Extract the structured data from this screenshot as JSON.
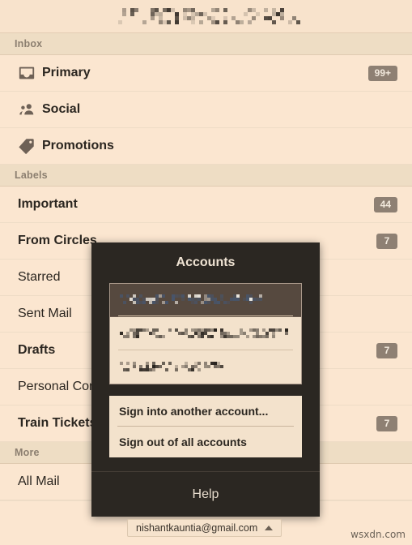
{
  "window": {
    "title_redacted": true,
    "title_placeholder": "▮▮▮▮ ▮ ▮▮ ▮ ▮▮ ▮▮ ▮"
  },
  "sections": [
    {
      "header": "Inbox",
      "rows": [
        {
          "label": "Primary",
          "icon": "inbox-icon",
          "badge": "99+",
          "bold": true
        },
        {
          "label": "Social",
          "icon": "people-icon",
          "badge": "",
          "bold": true
        },
        {
          "label": "Promotions",
          "icon": "price-tag-icon",
          "badge": "",
          "bold": true
        }
      ]
    },
    {
      "header": "Labels",
      "rows": [
        {
          "label": "Important",
          "icon": "",
          "badge": "44",
          "bold": true
        },
        {
          "label": "From Circles",
          "icon": "",
          "badge": "7",
          "bold": true
        },
        {
          "label": "Starred",
          "icon": "",
          "badge": "",
          "bold": false
        },
        {
          "label": "Sent Mail",
          "icon": "",
          "badge": "",
          "bold": false
        },
        {
          "label": "Drafts",
          "icon": "",
          "badge": "7",
          "bold": true
        },
        {
          "label": "Personal Conversations",
          "icon": "",
          "badge": "",
          "bold": false
        },
        {
          "label": "Train Tickets",
          "icon": "",
          "badge": "7",
          "bold": true
        }
      ]
    },
    {
      "header": "More",
      "rows": [
        {
          "label": "All Mail",
          "icon": "",
          "badge": "",
          "bold": false
        }
      ]
    }
  ],
  "dialog": {
    "title": "Accounts",
    "accounts": [
      {
        "redacted": true,
        "selected": true,
        "placeholder": "▮▮▮ ▮▮ ▮▮▮▮ ▮▮▮ ▮▮"
      },
      {
        "redacted": true,
        "selected": false,
        "placeholder": "▮▮▮▮▮▮ ▮▮ ▮▮▮▮▮▮ ▮▮▮…"
      },
      {
        "redacted": true,
        "selected": false,
        "placeholder": "▮▮ ▮▮ ▮▮▮▮ ▮ ▮▮ ▮"
      }
    ],
    "menu": [
      {
        "label": "Sign into another account..."
      },
      {
        "label": "Sign out of all accounts"
      }
    ],
    "help_label": "Help"
  },
  "bottom_bar": {
    "account_email": "nishantkauntia@gmail.com",
    "caret_icon": "caret-up-icon"
  },
  "watermark": "wsxdn.com",
  "colors": {
    "page_bg": "#fbe6d0",
    "section_header_bg": "#eeddc4",
    "badge_bg": "#8e8073",
    "dialog_bg": "#2b2722",
    "panel_bg": "#f3e2cc",
    "selected_account_bg": "#56493f",
    "text": "#2b2620"
  }
}
